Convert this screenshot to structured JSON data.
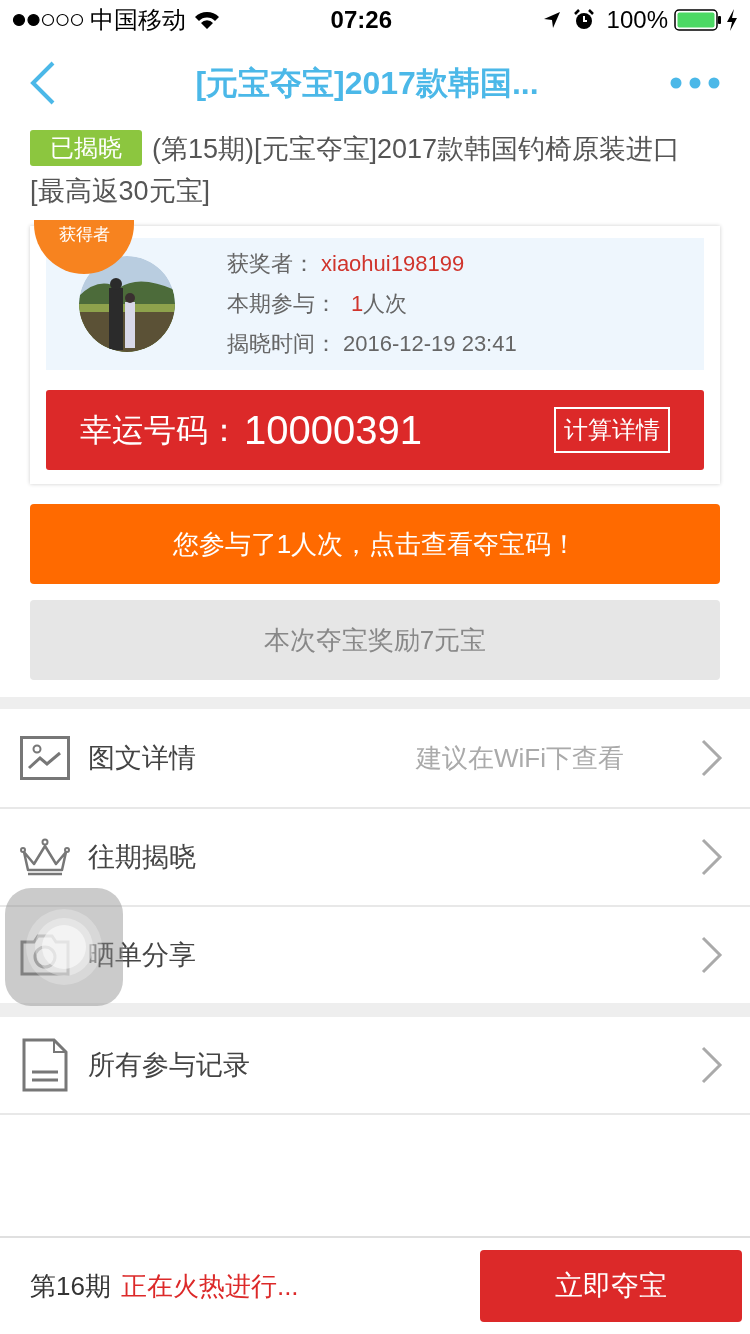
{
  "status_bar": {
    "carrier": "中国移动",
    "time": "07:26",
    "battery": "100%"
  },
  "nav": {
    "title": "[元宝夺宝]2017款韩国..."
  },
  "product": {
    "status_tag": "已揭晓",
    "title": "(第15期)[元宝夺宝]2017款韩国钓椅原装进口[最高返30元宝]"
  },
  "winner_card": {
    "ribbon": "获得者",
    "winner_label": "获奖者：",
    "winner_name": "xiaohui198199",
    "participation_label": "本期参与：",
    "participation_count": "1",
    "participation_unit": "人次",
    "reveal_label": "揭晓时间：",
    "reveal_time": "2016-12-19 23:41",
    "lucky_label": "幸运号码：",
    "lucky_number": "10000391",
    "detail_button": "计算详情"
  },
  "my_participation_button": "您参与了1人次，点击查看夺宝码！",
  "reward_button": "本次夺宝奖励7元宝",
  "menu_groups": [
    {
      "items": [
        {
          "kind": "picture",
          "label": "图文详情",
          "hint": "建议在WiFi下查看"
        },
        {
          "kind": "crown",
          "label": "往期揭晓"
        },
        {
          "kind": "camera",
          "label": "晒单分享"
        }
      ]
    },
    {
      "items": [
        {
          "kind": "document",
          "label": "所有参与记录"
        }
      ]
    }
  ],
  "bottom_bar": {
    "period": "第16期",
    "status": "正在火热进行...",
    "button": "立即夺宝"
  }
}
